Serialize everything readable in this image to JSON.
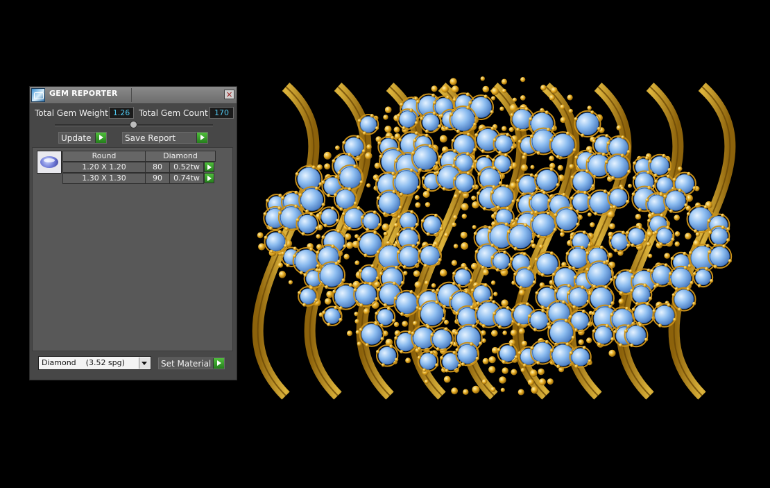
{
  "window": {
    "title": "GEM REPORTER",
    "close_symbol": "×"
  },
  "stats": {
    "weight_label": "Total Gem Weight",
    "weight_value": "1.26",
    "count_label": "Total Gem Count",
    "count_value": "170"
  },
  "actions": {
    "update_label": "Update",
    "save_report_label": "Save Report"
  },
  "report": {
    "headers": [
      "Round",
      "Diamond"
    ],
    "rows": [
      {
        "size": "1.20 X 1.20",
        "count": "80",
        "weight": "0.52tw"
      },
      {
        "size": "1.30 X 1.30",
        "count": "90",
        "weight": "0.74tw"
      }
    ]
  },
  "material": {
    "selected": "Diamond    (3.52 spg)",
    "set_label": "Set Material"
  },
  "colors": {
    "metal": "#d4a017",
    "gem": "#7fb2ea",
    "accent_value": "#4fc8f0",
    "go_button": "#3aa52b"
  },
  "icons": [
    "gem-reporter-icon",
    "close-icon",
    "slider-thumb",
    "play-arrow-icon",
    "gem-thumbnail-icon",
    "chevron-down-icon"
  ]
}
